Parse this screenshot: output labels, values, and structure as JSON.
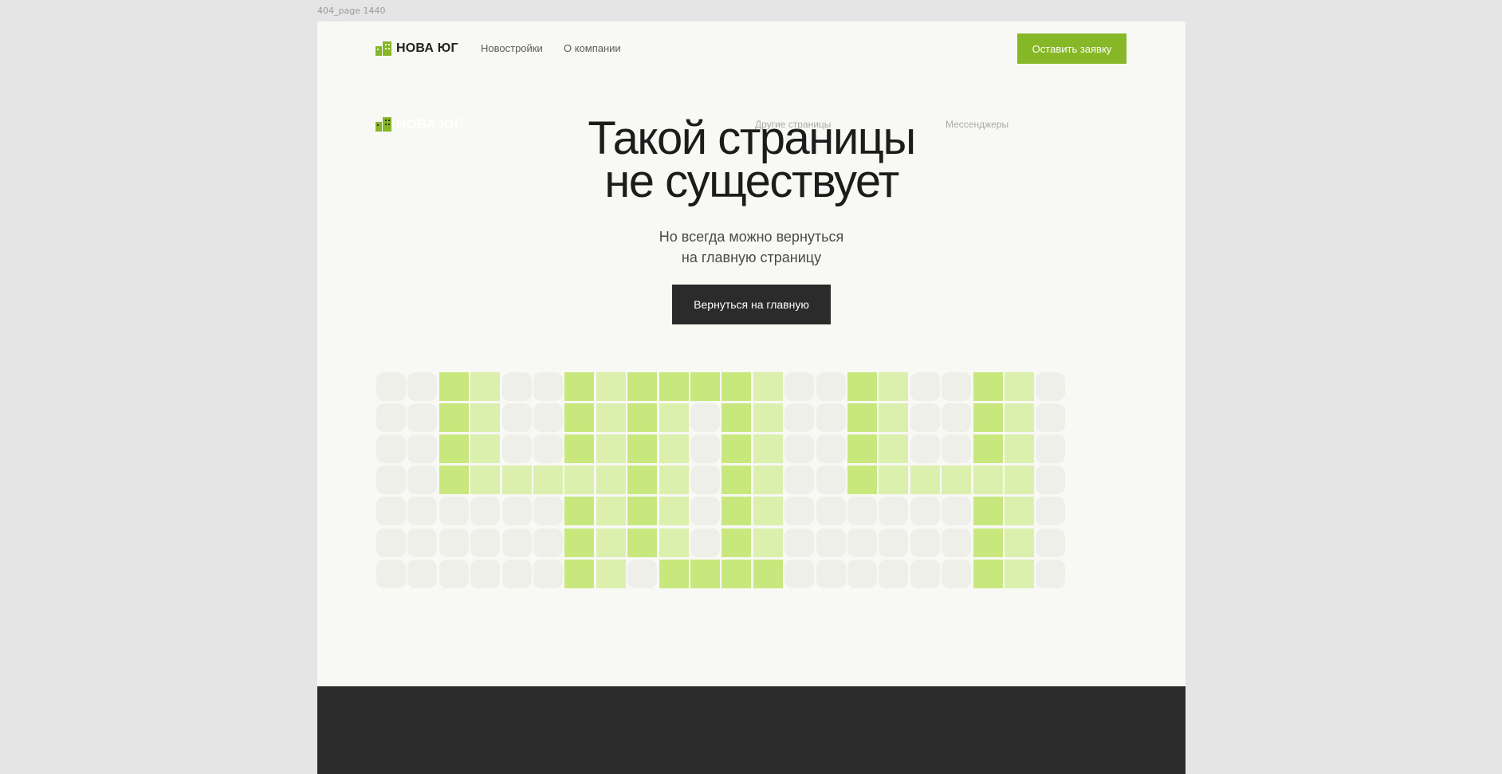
{
  "frame_label": "404_page 1440",
  "header": {
    "logo_text": "НОВА ЮГ",
    "nav": [
      "Новостройки",
      "О компании"
    ],
    "cta_label": "Оставить заявку"
  },
  "hero": {
    "title_line1": "Такой страницы",
    "title_line2": "не существует",
    "subtitle_line1": "Но всегда можно вернуться",
    "subtitle_line2": "на главную страницу",
    "button_label": "Вернуться на главную"
  },
  "footer": {
    "logo_text": "НОВА ЮГ",
    "col1_title": "Другие страницы",
    "col2_title": "Мессенджеры"
  },
  "colors": {
    "accent": "#86b726",
    "dark": "#2b2b2b",
    "pixel_on_dark": "#c8e87d",
    "pixel_on_light": "#dcf0ae",
    "pixel_off": "#efefea",
    "page_bg": "#f8f8f4"
  },
  "pixel_grid": [
    "0012001211112001200120",
    "0012001212012001200120",
    "0012001212012001200120",
    "0012222212012001222220",
    "0000001212012000000120",
    "0000001212012000000120",
    "0000001201111000000120"
  ]
}
